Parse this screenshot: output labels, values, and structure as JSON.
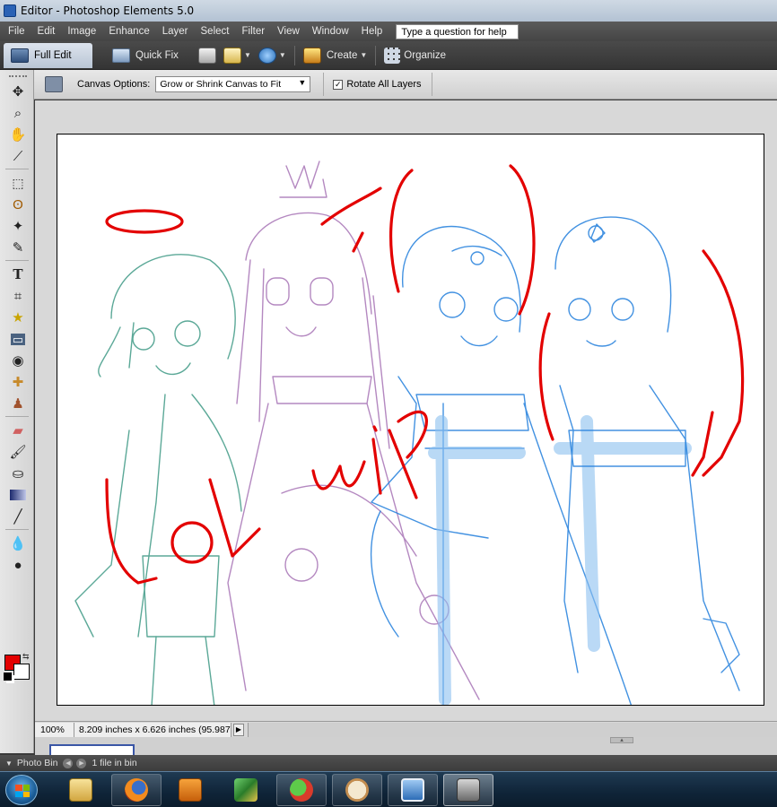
{
  "window": {
    "title": "Editor - Photoshop Elements 5.0"
  },
  "menu": {
    "items": [
      "File",
      "Edit",
      "Image",
      "Enhance",
      "Layer",
      "Select",
      "Filter",
      "View",
      "Window",
      "Help"
    ],
    "help_placeholder": "Type a question for help"
  },
  "modebar": {
    "full_edit": "Full Edit",
    "quick_fix": "Quick Fix",
    "create": "Create",
    "organize": "Organize"
  },
  "options": {
    "canvas_options_label": "Canvas Options:",
    "canvas_options_value": "Grow or Shrink Canvas to Fit",
    "rotate_all_layers_label": "Rotate All Layers",
    "rotate_all_layers_checked": true
  },
  "tools": [
    "move-tool",
    "zoom-tool",
    "hand-tool",
    "eyedropper-tool",
    "marquee-tool",
    "lasso-tool",
    "magic-wand-tool",
    "selection-brush-tool",
    "type-tool",
    "crop-tool",
    "cookie-cutter-tool",
    "straighten-tool",
    "red-eye-tool",
    "healing-brush-tool",
    "clone-stamp-tool",
    "eraser-tool",
    "brush-tool",
    "paint-bucket-tool",
    "gradient-tool",
    "line-tool",
    "blur-tool",
    "sponge-tool"
  ],
  "colors": {
    "foreground": "#e30000",
    "background": "#ffffff",
    "accent": "#3a56a6"
  },
  "artwork": {
    "scribble_text": [
      "Lol",
      "wip"
    ]
  },
  "status": {
    "zoom": "100%",
    "doc_info": "8.209 inches x 6.626 inches (95.987 ..."
  },
  "photo_bin": {
    "label": "Photo Bin",
    "count_text": "1 file in bin"
  },
  "taskbar": {
    "apps": [
      "windows-explorer",
      "firefox",
      "media-player",
      "paint-program",
      "messenger",
      "photoshop-elements",
      "photo-viewer",
      "camera-app"
    ]
  }
}
